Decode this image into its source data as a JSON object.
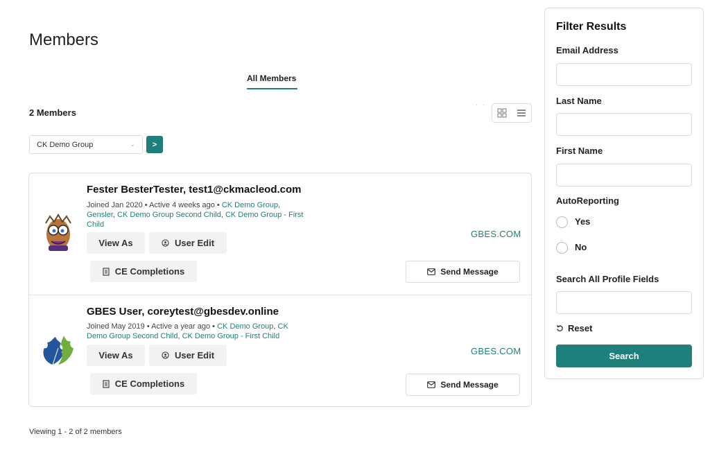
{
  "page": {
    "title": "Members",
    "tab_all": "All Members",
    "count": "2 Members",
    "dots": "· ·"
  },
  "group_filter": {
    "selected": "CK Demo Group",
    "go_label": ">"
  },
  "members": [
    {
      "name": "Fester BesterTester, test1@ckmacleod.com",
      "meta_prefix": "Joined Jan 2020 • Active 4 weeks ago •",
      "groups": [
        "CK Demo Group",
        "Gensler",
        "CK Demo Group Second Child",
        "CK Demo Group - First Child"
      ],
      "site": "GBES.COM",
      "view_as": "View As",
      "user_edit": "User Edit",
      "ce_completions": "CE Completions",
      "send_message": "Send Message"
    },
    {
      "name": "GBES User, coreytest@gbesdev.online",
      "meta_prefix": "Joined May 2019 • Active a year ago •",
      "groups": [
        "CK Demo Group",
        "CK Demo Group Second Child",
        "CK Demo Group - First Child"
      ],
      "site": "GBES.COM",
      "view_as": "View As",
      "user_edit": "User Edit",
      "ce_completions": "CE Completions",
      "send_message": "Send Message"
    }
  ],
  "footer": {
    "viewing": "Viewing 1 - 2 of 2 members"
  },
  "filter": {
    "title": "Filter Results",
    "email_label": "Email Address",
    "last_name_label": "Last Name",
    "first_name_label": "First Name",
    "autoreporting_label": "AutoReporting",
    "yes_label": "Yes",
    "no_label": "No",
    "search_all_label": "Search All Profile Fields",
    "reset_label": "Reset",
    "search_button": "Search"
  },
  "colors": {
    "accent": "#1f7f7a",
    "border": "#dddddd",
    "button_bg": "#f0f2f3"
  }
}
